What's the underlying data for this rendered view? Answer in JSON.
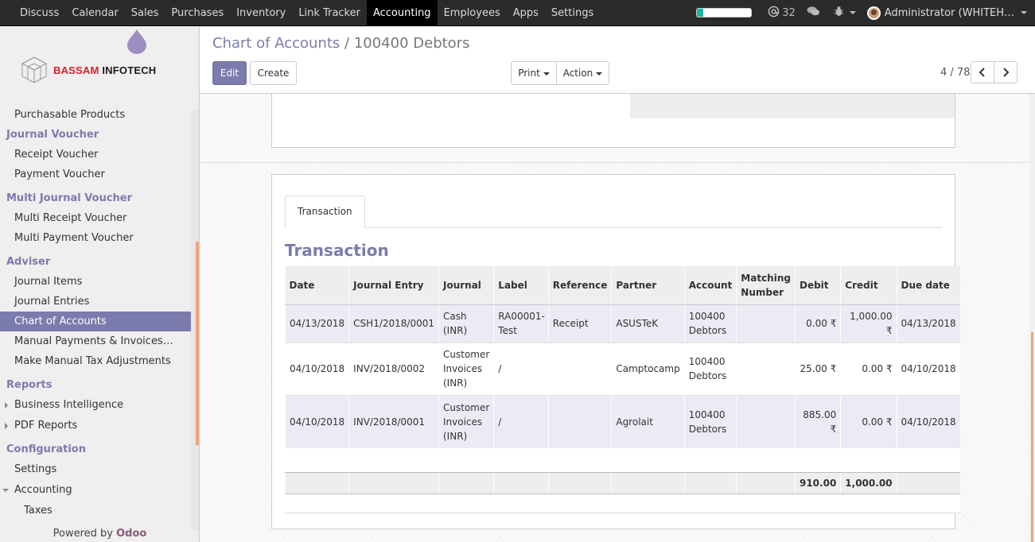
{
  "topbar": {
    "menu": [
      "Discuss",
      "Calendar",
      "Sales",
      "Purchases",
      "Inventory",
      "Link Tracker",
      "Accounting",
      "Employees",
      "Apps",
      "Settings"
    ],
    "active": "Accounting",
    "progress": 0.12,
    "mentions_count": "32",
    "user": "Administrator (WHITEH…"
  },
  "sidebar": {
    "brand_red": "BASSAM",
    "brand_rest": " INFOTECH",
    "purchasable": "Purchasable Products",
    "journal_voucher": "Journal Voucher",
    "receipt_voucher": "Receipt Voucher",
    "payment_voucher": "Payment Voucher",
    "multi_journal_voucher": "Multi Journal Voucher",
    "multi_receipt_voucher": "Multi Receipt Voucher",
    "multi_payment_voucher": "Multi Payment Voucher",
    "adviser": "Adviser",
    "journal_items": "Journal Items",
    "journal_entries": "Journal Entries",
    "chart_of_accounts": "Chart of Accounts",
    "manual_payments": "Manual Payments & Invoices…",
    "manual_tax": "Make Manual Tax Adjustments",
    "reports": "Reports",
    "business_intelligence": "Business Intelligence",
    "pdf_reports": "PDF Reports",
    "configuration": "Configuration",
    "settings": "Settings",
    "accounting": "Accounting",
    "taxes": "Taxes",
    "powered_by": "Powered by",
    "odoo": "Odoo"
  },
  "control": {
    "crumb_parent": "Chart of Accounts",
    "crumb_sep": " / ",
    "crumb_current": "100400 Debtors",
    "edit": "Edit",
    "create": "Create",
    "print": "Print",
    "action": "Action",
    "pager": "4 / 78"
  },
  "tab_label": "Transaction",
  "section_title": "Transaction",
  "table": {
    "headers": [
      "Date",
      "Journal Entry",
      "Journal",
      "Label",
      "Reference",
      "Partner",
      "Account",
      "Matching Number",
      "Debit",
      "Credit",
      "Due date"
    ],
    "rows": [
      {
        "date": "04/13/2018",
        "entry": "CSH1/2018/0001",
        "journal": "Cash (INR)",
        "label": "RA00001-Test",
        "reference": "Receipt",
        "partner": "ASUSTeK",
        "account": "100400 Debtors",
        "matching": "",
        "debit": "0.00 ₹",
        "credit": "1,000.00 ₹",
        "due": "04/13/2018"
      },
      {
        "date": "04/10/2018",
        "entry": "INV/2018/0002",
        "journal": "Customer Invoices (INR)",
        "label": "/",
        "reference": "",
        "partner": "Camptocamp",
        "account": "100400 Debtors",
        "matching": "",
        "debit": "25.00 ₹",
        "credit": "0.00 ₹",
        "due": "04/10/2018"
      },
      {
        "date": "04/10/2018",
        "entry": "INV/2018/0001",
        "journal": "Customer Invoices (INR)",
        "label": "/",
        "reference": "",
        "partner": "Agrolait",
        "account": "100400 Debtors",
        "matching": "",
        "debit": "885.00 ₹",
        "credit": "0.00 ₹",
        "due": "04/10/2018"
      }
    ],
    "total_debit": "910.00",
    "total_credit": "1,000.00"
  }
}
